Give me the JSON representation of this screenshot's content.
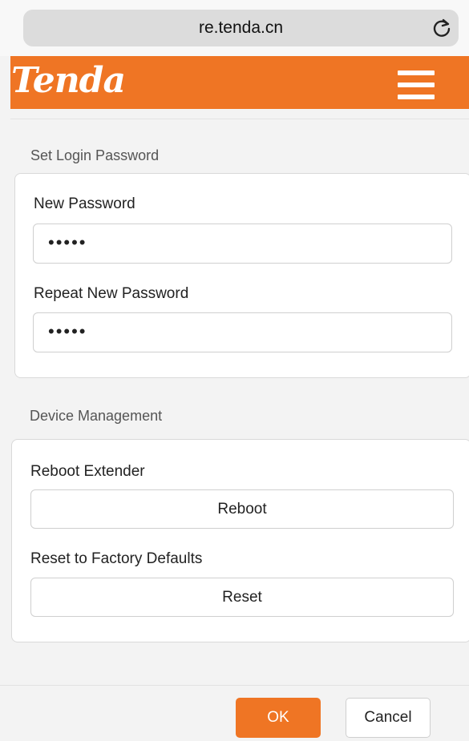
{
  "browser": {
    "url": "re.tenda.cn"
  },
  "header": {
    "logo_text": "Tenda",
    "brand_color": "#ef7524"
  },
  "login_password": {
    "section_title": "Set Login Password",
    "new_password_label": "New Password",
    "new_password_value": "•••••",
    "repeat_password_label": "Repeat New Password",
    "repeat_password_value": "•••••"
  },
  "device_management": {
    "section_title": "Device Management",
    "reboot_label": "Reboot Extender",
    "reboot_button": "Reboot",
    "reset_label": "Reset to Factory Defaults",
    "reset_button": "Reset"
  },
  "footer": {
    "ok_label": "OK",
    "cancel_label": "Cancel"
  }
}
